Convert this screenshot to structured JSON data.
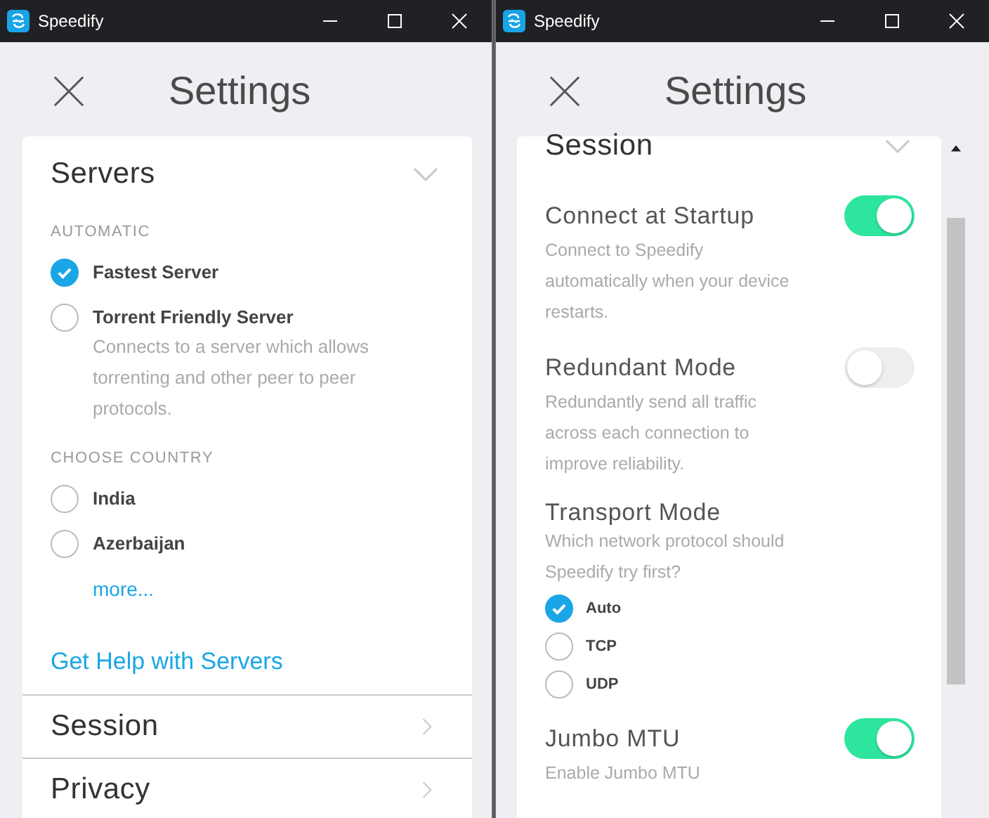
{
  "left_window": {
    "title": "Speedify",
    "heading": "Settings",
    "servers": {
      "title": "Servers",
      "expanded": true,
      "groups": [
        {
          "label": "AUTOMATIC",
          "options": [
            {
              "name": "Fastest Server",
              "selected": true
            },
            {
              "name": "Torrent Friendly Server",
              "description": "Connects to a server which allows torrenting and other peer to peer protocols.",
              "selected": false
            }
          ]
        },
        {
          "label": "CHOOSE COUNTRY",
          "options": [
            {
              "name": "India",
              "selected": false
            },
            {
              "name": "Azerbaijan",
              "selected": false
            }
          ],
          "more": "more..."
        }
      ],
      "help_link": "Get Help with Servers"
    },
    "sections": [
      {
        "title": "Session",
        "expanded": false
      },
      {
        "title": "Privacy",
        "expanded": false
      }
    ]
  },
  "right_window": {
    "title": "Speedify",
    "heading": "Settings",
    "section": {
      "title": "Session",
      "expanded": true
    },
    "settings": [
      {
        "kind": "toggle",
        "title": "Connect at Startup",
        "description": "Connect to Speedify automatically when your device restarts.",
        "on": true
      },
      {
        "kind": "toggle",
        "title": "Redundant Mode",
        "description": "Redundantly send all traffic across each connection to improve reliability.",
        "on": false
      },
      {
        "kind": "radio",
        "title": "Transport Mode",
        "description": "Which network protocol should Speedify try first?",
        "options": [
          {
            "label": "Auto",
            "selected": true
          },
          {
            "label": "TCP",
            "selected": false
          },
          {
            "label": "UDP",
            "selected": false
          }
        ]
      },
      {
        "kind": "toggle",
        "title": "Jumbo MTU",
        "description": "Enable Jumbo MTU",
        "on": true
      }
    ]
  }
}
